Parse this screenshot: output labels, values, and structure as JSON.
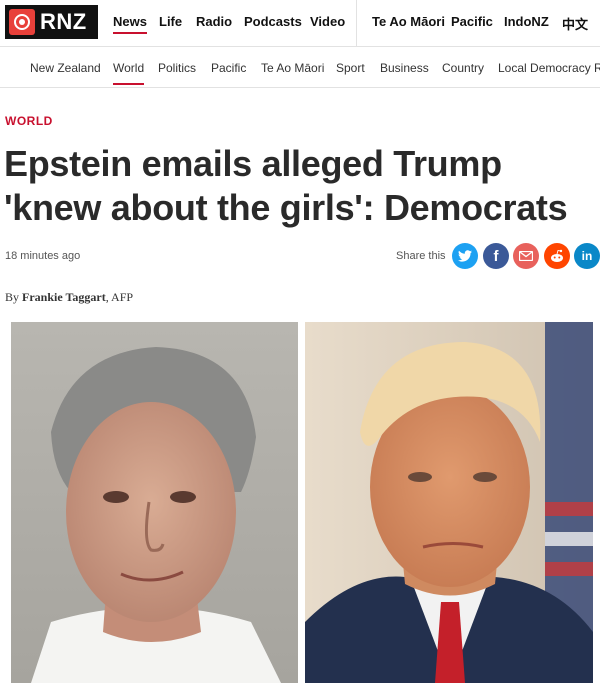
{
  "site": {
    "logo_text": "RNZ",
    "logo_icon": "rnz-mark-icon"
  },
  "top_nav": [
    {
      "label": "News",
      "active": true
    },
    {
      "label": "Life"
    },
    {
      "label": "Radio"
    },
    {
      "label": "Podcasts"
    },
    {
      "label": "Video"
    },
    {
      "label": "Te Ao Māori"
    },
    {
      "label": "Pacific"
    },
    {
      "label": "IndoNZ"
    },
    {
      "label": "中文"
    }
  ],
  "sub_nav": [
    {
      "label": "New Zealand"
    },
    {
      "label": "World",
      "active": true
    },
    {
      "label": "Politics"
    },
    {
      "label": "Pacific"
    },
    {
      "label": "Te Ao Māori"
    },
    {
      "label": "Sport"
    },
    {
      "label": "Business"
    },
    {
      "label": "Country"
    },
    {
      "label": "Local Democracy R"
    }
  ],
  "article": {
    "section": "WORLD",
    "headline": "Epstein emails alleged Trump 'knew about the girls': Democrats",
    "timestamp": "18 minutes ago",
    "share_label": "Share this",
    "byline_prefix": "By",
    "author": "Frankie Taggart",
    "agency": ", AFP"
  },
  "share_buttons": [
    {
      "icon": "twitter-icon",
      "glyph": "t",
      "color": "#1da1f2"
    },
    {
      "icon": "facebook-icon",
      "glyph": "f",
      "color": "#3b5998"
    },
    {
      "icon": "email-icon",
      "glyph": "✉",
      "color": "#e8615c"
    },
    {
      "icon": "reddit-icon",
      "glyph": "●",
      "color": "#ff4500"
    },
    {
      "icon": "linkedin-icon",
      "glyph": "in",
      "color": "#0a88c8"
    }
  ],
  "colors": {
    "accent": "#c8102e",
    "headline": "#2a2a2a"
  }
}
